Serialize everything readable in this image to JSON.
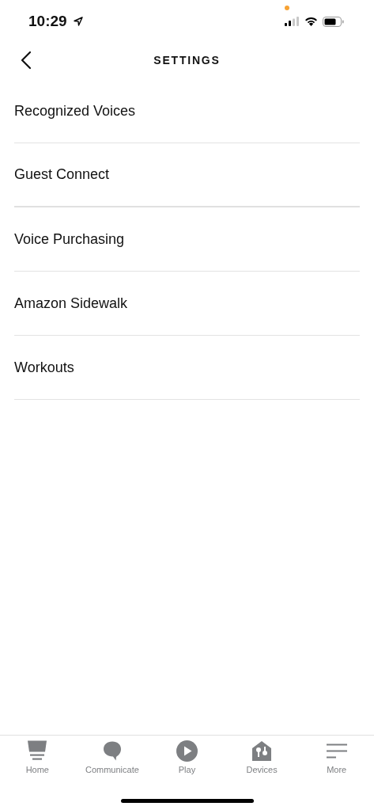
{
  "status_bar": {
    "time": "10:29"
  },
  "header": {
    "title": "SETTINGS"
  },
  "items": [
    {
      "label": "Recognized Voices"
    },
    {
      "label": "Guest Connect"
    },
    {
      "label": "Voice Purchasing"
    },
    {
      "label": "Amazon Sidewalk"
    },
    {
      "label": "Workouts"
    }
  ],
  "tab_bar": [
    {
      "label": "Home",
      "kind": "home"
    },
    {
      "label": "Communicate",
      "kind": "communicate"
    },
    {
      "label": "Play",
      "kind": "play"
    },
    {
      "label": "Devices",
      "kind": "devices"
    },
    {
      "label": "More",
      "kind": "more"
    }
  ]
}
